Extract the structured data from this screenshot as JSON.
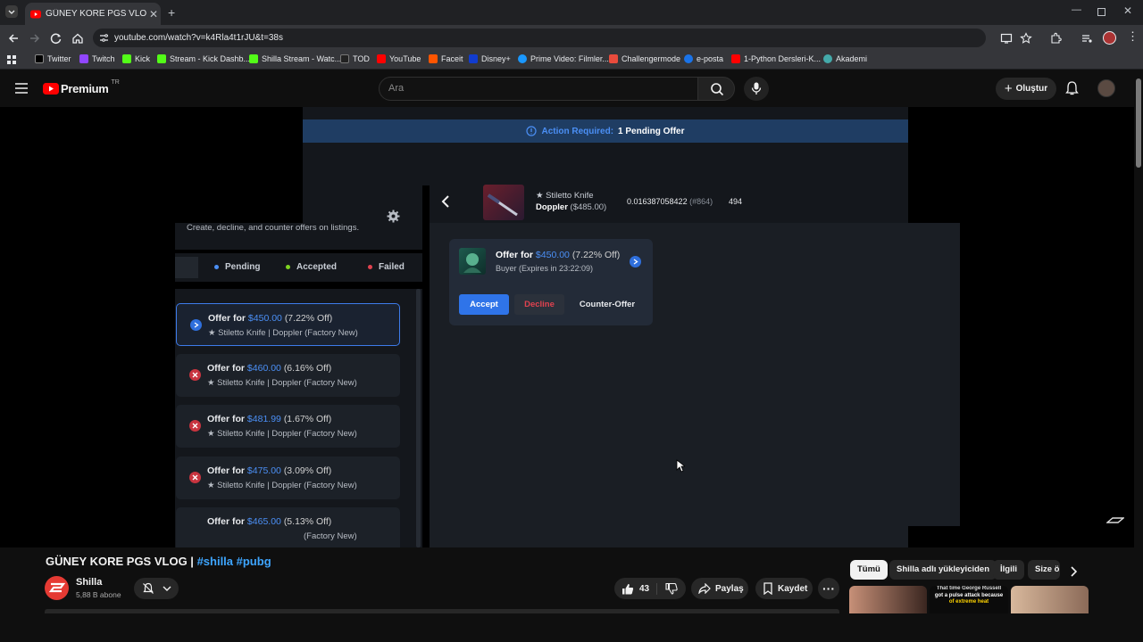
{
  "browser": {
    "tab_title": "GÜNEY KORE PGS VLOG | #shilla",
    "url": "youtube.com/watch?v=k4Rla4t1rJU&t=38s",
    "bookmarks": [
      "Twitter",
      "Twitch",
      "Kick",
      "Stream - Kick Dashb...",
      "Shilla Stream - Watc...",
      "TOD",
      "YouTube",
      "Faceit",
      "Disney+",
      "Prime Video: Filmler...",
      "Challengermode",
      "e-posta",
      "1-Python Dersleri-K...",
      "Akademi"
    ]
  },
  "youtube": {
    "logo_text": "Premium",
    "region": "TR",
    "search_placeholder": "Ara",
    "create_label": "Oluştur"
  },
  "video": {
    "banner_label": "Action Required:",
    "banner_value": "1 Pending Offer",
    "subtitle": "Create, decline, and counter offers on listings.",
    "filters": [
      "Pending",
      "Accepted",
      "Failed"
    ],
    "item_star_name": "★ Stiletto Knife",
    "item_name": "Doppler",
    "item_price": "($485.00)",
    "item_float": "0.016387058422",
    "item_pattern": "(#864)",
    "item_seed": "494",
    "offers": [
      {
        "prefix": "Offer for",
        "price": "$450.00",
        "discount": "(7.22% Off)",
        "item": "★ Stiletto Knife | Doppler (Factory New)"
      },
      {
        "prefix": "Offer for",
        "price": "$460.00",
        "discount": "(6.16% Off)",
        "item": "★ Stiletto Knife | Doppler (Factory New)"
      },
      {
        "prefix": "Offer for",
        "price": "$481.99",
        "discount": "(1.67% Off)",
        "item": "★ Stiletto Knife | Doppler (Factory New)"
      },
      {
        "prefix": "Offer for",
        "price": "$475.00",
        "discount": "(3.09% Off)",
        "item": "★ Stiletto Knife | Doppler (Factory New)"
      },
      {
        "prefix": "Offer for",
        "price": "$465.00",
        "discount": "(5.13% Off)",
        "item": "(Factory New)"
      }
    ],
    "detail": {
      "prefix": "Offer for",
      "price": "$450.00",
      "discount": "(7.22% Off)",
      "buyer": "Buyer (Expires in 23:22:09)",
      "accept": "Accept",
      "decline": "Decline",
      "counter": "Counter-Offer"
    }
  },
  "info": {
    "title": "GÜNEY KORE PGS VLOG |",
    "hashtags": "#shilla #pubg",
    "channel": "Shilla",
    "subs": "5,88 B abone",
    "likes": "43",
    "share": "Paylaş",
    "save": "Kaydet"
  },
  "chips": [
    "Tümü",
    "Shilla adlı yükleyiciden",
    "İlgili",
    "Size ö"
  ],
  "thumb_caption": [
    "That time George Russell",
    "got a pulse attack because",
    "of extreme heat"
  ]
}
